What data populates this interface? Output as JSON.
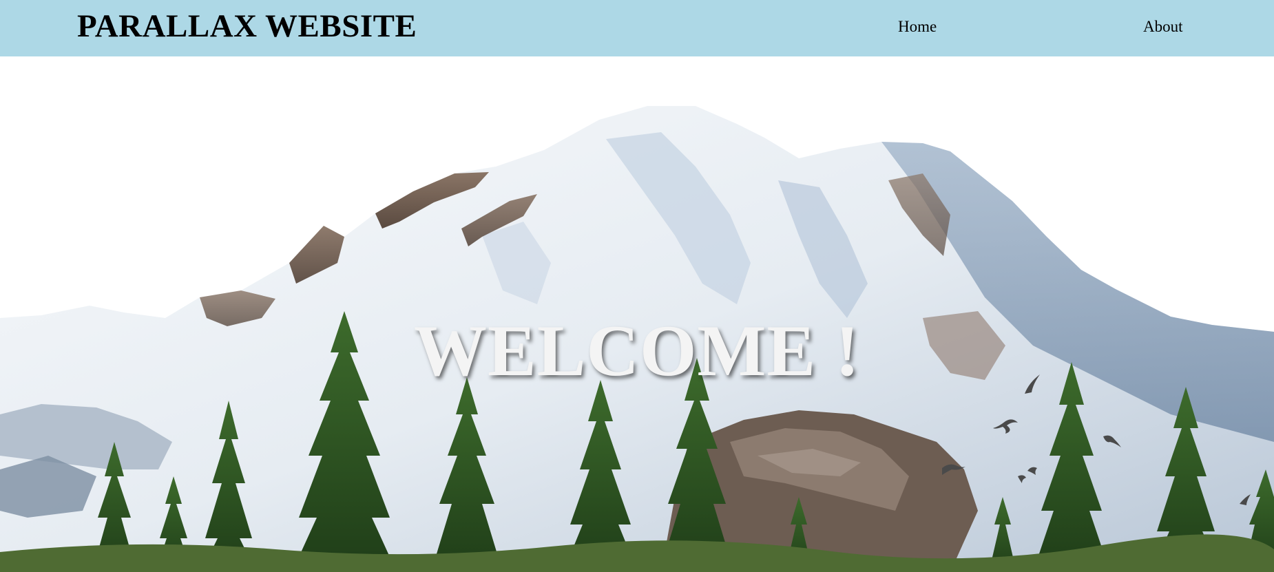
{
  "header": {
    "title": "PARALLAX WEBSITE",
    "nav": [
      {
        "label": "Home"
      },
      {
        "label": "About"
      }
    ],
    "background_color": "#add8e6"
  },
  "hero": {
    "heading": "WELCOME !",
    "heading_color": "#f4f4f4",
    "scene": [
      "snow-capped-mountain",
      "evergreen-trees",
      "flying-birds"
    ]
  }
}
